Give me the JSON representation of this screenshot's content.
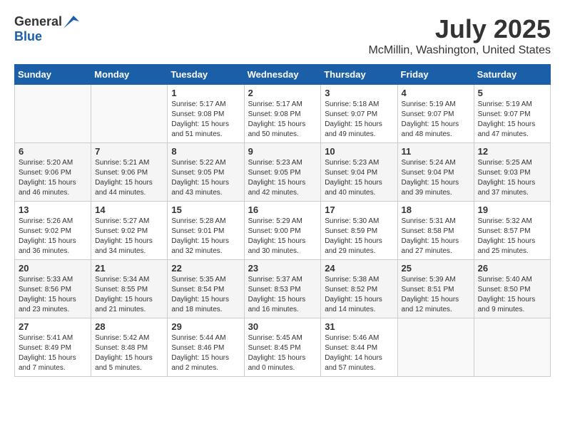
{
  "header": {
    "logo_general": "General",
    "logo_blue": "Blue",
    "title": "July 2025",
    "subtitle": "McMillin, Washington, United States"
  },
  "days_of_week": [
    "Sunday",
    "Monday",
    "Tuesday",
    "Wednesday",
    "Thursday",
    "Friday",
    "Saturday"
  ],
  "weeks": [
    [
      {
        "day": "",
        "info": ""
      },
      {
        "day": "",
        "info": ""
      },
      {
        "day": "1",
        "info": "Sunrise: 5:17 AM\nSunset: 9:08 PM\nDaylight: 15 hours and 51 minutes."
      },
      {
        "day": "2",
        "info": "Sunrise: 5:17 AM\nSunset: 9:08 PM\nDaylight: 15 hours and 50 minutes."
      },
      {
        "day": "3",
        "info": "Sunrise: 5:18 AM\nSunset: 9:07 PM\nDaylight: 15 hours and 49 minutes."
      },
      {
        "day": "4",
        "info": "Sunrise: 5:19 AM\nSunset: 9:07 PM\nDaylight: 15 hours and 48 minutes."
      },
      {
        "day": "5",
        "info": "Sunrise: 5:19 AM\nSunset: 9:07 PM\nDaylight: 15 hours and 47 minutes."
      }
    ],
    [
      {
        "day": "6",
        "info": "Sunrise: 5:20 AM\nSunset: 9:06 PM\nDaylight: 15 hours and 46 minutes."
      },
      {
        "day": "7",
        "info": "Sunrise: 5:21 AM\nSunset: 9:06 PM\nDaylight: 15 hours and 44 minutes."
      },
      {
        "day": "8",
        "info": "Sunrise: 5:22 AM\nSunset: 9:05 PM\nDaylight: 15 hours and 43 minutes."
      },
      {
        "day": "9",
        "info": "Sunrise: 5:23 AM\nSunset: 9:05 PM\nDaylight: 15 hours and 42 minutes."
      },
      {
        "day": "10",
        "info": "Sunrise: 5:23 AM\nSunset: 9:04 PM\nDaylight: 15 hours and 40 minutes."
      },
      {
        "day": "11",
        "info": "Sunrise: 5:24 AM\nSunset: 9:04 PM\nDaylight: 15 hours and 39 minutes."
      },
      {
        "day": "12",
        "info": "Sunrise: 5:25 AM\nSunset: 9:03 PM\nDaylight: 15 hours and 37 minutes."
      }
    ],
    [
      {
        "day": "13",
        "info": "Sunrise: 5:26 AM\nSunset: 9:02 PM\nDaylight: 15 hours and 36 minutes."
      },
      {
        "day": "14",
        "info": "Sunrise: 5:27 AM\nSunset: 9:02 PM\nDaylight: 15 hours and 34 minutes."
      },
      {
        "day": "15",
        "info": "Sunrise: 5:28 AM\nSunset: 9:01 PM\nDaylight: 15 hours and 32 minutes."
      },
      {
        "day": "16",
        "info": "Sunrise: 5:29 AM\nSunset: 9:00 PM\nDaylight: 15 hours and 30 minutes."
      },
      {
        "day": "17",
        "info": "Sunrise: 5:30 AM\nSunset: 8:59 PM\nDaylight: 15 hours and 29 minutes."
      },
      {
        "day": "18",
        "info": "Sunrise: 5:31 AM\nSunset: 8:58 PM\nDaylight: 15 hours and 27 minutes."
      },
      {
        "day": "19",
        "info": "Sunrise: 5:32 AM\nSunset: 8:57 PM\nDaylight: 15 hours and 25 minutes."
      }
    ],
    [
      {
        "day": "20",
        "info": "Sunrise: 5:33 AM\nSunset: 8:56 PM\nDaylight: 15 hours and 23 minutes."
      },
      {
        "day": "21",
        "info": "Sunrise: 5:34 AM\nSunset: 8:55 PM\nDaylight: 15 hours and 21 minutes."
      },
      {
        "day": "22",
        "info": "Sunrise: 5:35 AM\nSunset: 8:54 PM\nDaylight: 15 hours and 18 minutes."
      },
      {
        "day": "23",
        "info": "Sunrise: 5:37 AM\nSunset: 8:53 PM\nDaylight: 15 hours and 16 minutes."
      },
      {
        "day": "24",
        "info": "Sunrise: 5:38 AM\nSunset: 8:52 PM\nDaylight: 15 hours and 14 minutes."
      },
      {
        "day": "25",
        "info": "Sunrise: 5:39 AM\nSunset: 8:51 PM\nDaylight: 15 hours and 12 minutes."
      },
      {
        "day": "26",
        "info": "Sunrise: 5:40 AM\nSunset: 8:50 PM\nDaylight: 15 hours and 9 minutes."
      }
    ],
    [
      {
        "day": "27",
        "info": "Sunrise: 5:41 AM\nSunset: 8:49 PM\nDaylight: 15 hours and 7 minutes."
      },
      {
        "day": "28",
        "info": "Sunrise: 5:42 AM\nSunset: 8:48 PM\nDaylight: 15 hours and 5 minutes."
      },
      {
        "day": "29",
        "info": "Sunrise: 5:44 AM\nSunset: 8:46 PM\nDaylight: 15 hours and 2 minutes."
      },
      {
        "day": "30",
        "info": "Sunrise: 5:45 AM\nSunset: 8:45 PM\nDaylight: 15 hours and 0 minutes."
      },
      {
        "day": "31",
        "info": "Sunrise: 5:46 AM\nSunset: 8:44 PM\nDaylight: 14 hours and 57 minutes."
      },
      {
        "day": "",
        "info": ""
      },
      {
        "day": "",
        "info": ""
      }
    ]
  ]
}
